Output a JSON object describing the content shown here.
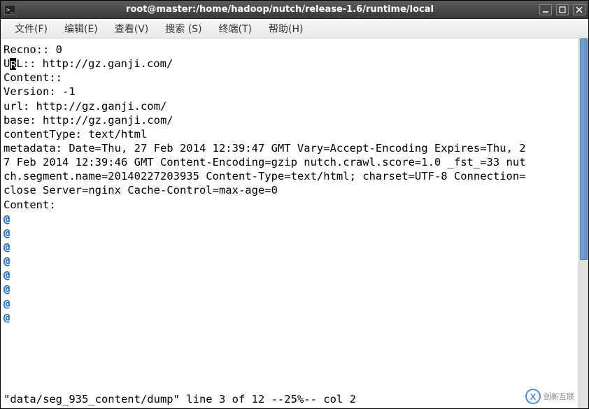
{
  "window": {
    "title": "root@master:/home/hadoop/nutch/release-1.6/runtime/local"
  },
  "menu": {
    "file": "文件(F)",
    "edit": "编辑(E)",
    "view": "查看(V)",
    "search": "搜索 (S)",
    "terminal": "终端(T)",
    "help": "帮助(H)"
  },
  "terminal": {
    "lines": {
      "l0": "",
      "l1": "Recno:: 0",
      "l2a": "U",
      "l2b": "L:: http://gz.ganji.com/",
      "l3": "",
      "l4": "Content::",
      "l5": "Version: -1",
      "l6": "url: http://gz.ganji.com/",
      "l7": "base: http://gz.ganji.com/",
      "l8": "contentType: text/html",
      "l9": "metadata: Date=Thu, 27 Feb 2014 12:39:47 GMT Vary=Accept-Encoding Expires=Thu, 2",
      "l10": "7 Feb 2014 12:39:46 GMT Content-Encoding=gzip nutch.crawl.score=1.0 _fst_=33 nut",
      "l11": "ch.segment.name=20140227203935 Content-Type=text/html; charset=UTF-8 Connection=",
      "l12": "close Server=nginx Cache-Control=max-age=0",
      "l13": "Content:",
      "at1": "@",
      "at2": "@",
      "at3": "@",
      "at4": "@",
      "at5": "@",
      "at6": "@",
      "at7": "@",
      "at8": "@"
    },
    "status": "\"data/seg_935_content/dump\" line 3 of 12 --25%-- col 2"
  },
  "watermark": {
    "text": "创新互联"
  }
}
